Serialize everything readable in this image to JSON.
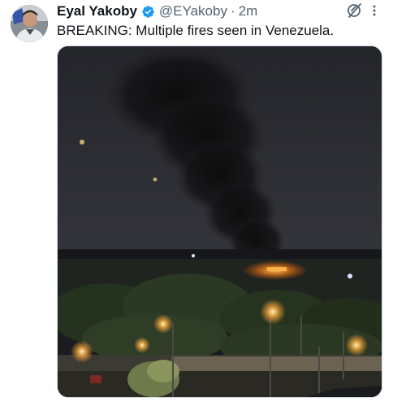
{
  "tweet": {
    "author_name": "Eyal Yakoby",
    "handle": "@EYakoby",
    "separator": "·",
    "time": "2m",
    "text": "BREAKING: Multiple fires seen in Venezuela."
  },
  "icons": {
    "verified": "verified-badge-icon",
    "grok": "grok-icon",
    "more": "more-options-icon"
  },
  "colors": {
    "verified_blue": "#1d9bf0",
    "secondary_text": "#536471",
    "primary_text": "#0f1419"
  }
}
